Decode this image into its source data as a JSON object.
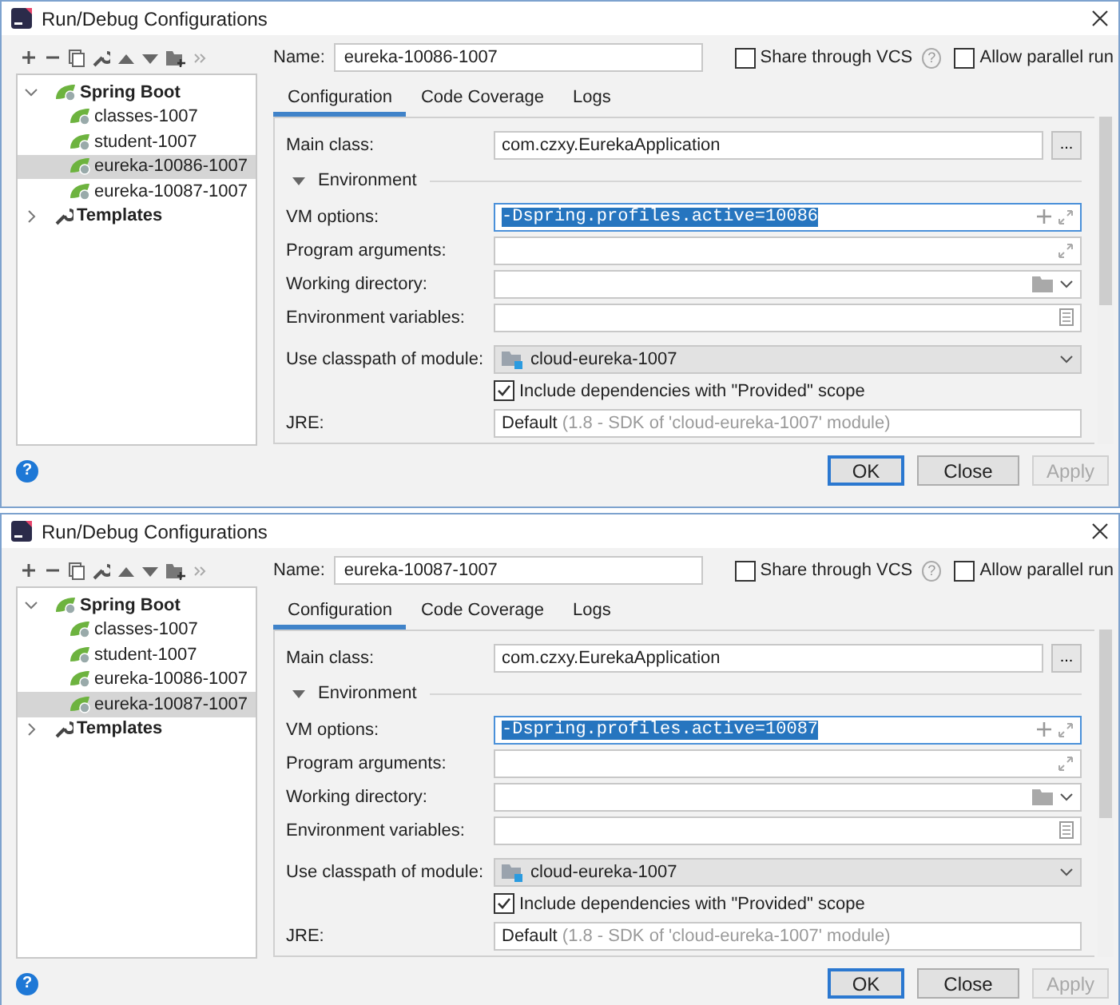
{
  "dialogs": [
    {
      "title": "Run/Debug Configurations",
      "name": {
        "label": "Name:",
        "value": "eureka-10086-1007"
      },
      "share": {
        "label": "Share through VCS",
        "checked": false,
        "help": "?"
      },
      "parallel": {
        "label": "Allow parallel run",
        "checked": false
      },
      "tree": [
        {
          "label": "Spring Boot",
          "kind": "group",
          "expanded": true,
          "selected": false,
          "children": [
            {
              "label": "classes-1007",
              "kind": "config",
              "selected": false
            },
            {
              "label": "student-1007",
              "kind": "config",
              "selected": false
            },
            {
              "label": "eureka-10086-1007",
              "kind": "config",
              "selected": true
            },
            {
              "label": "eureka-10087-1007",
              "kind": "config",
              "selected": false
            }
          ]
        },
        {
          "label": "Templates",
          "kind": "template",
          "expanded": false,
          "selected": false
        }
      ],
      "tabs": [
        {
          "label": "Configuration",
          "selected": true
        },
        {
          "label": "Code Coverage",
          "selected": false
        },
        {
          "label": "Logs",
          "selected": false
        }
      ],
      "form": {
        "main_class": {
          "label": "Main class:",
          "value": "com.czxy.EurekaApplication",
          "button": "..."
        },
        "environment": {
          "label": "Environment",
          "expanded": true
        },
        "fields": [
          {
            "label": "VM options:",
            "kind": "vm",
            "value": "-Dspring.profiles.active=10086",
            "focused": true,
            "text_selected": true
          },
          {
            "label": "Program arguments:",
            "kind": "expand",
            "focused": false
          },
          {
            "label": "Working directory:",
            "kind": "folder",
            "focused": false
          },
          {
            "label": "Environment variables:",
            "kind": "list",
            "focused": false
          }
        ],
        "module": {
          "label": "Use classpath of module:",
          "value": "cloud-eureka-1007"
        },
        "include": {
          "label": "Include dependencies with \"Provided\" scope",
          "checked": true
        },
        "jre": {
          "label": "JRE:",
          "value": "Default",
          "detail": "(1.8 - SDK of 'cloud-eureka-1007' module)"
        }
      },
      "help": "?",
      "buttons": [
        {
          "label": "OK",
          "kind": "default",
          "disabled": false
        },
        {
          "label": "Close",
          "kind": "normal",
          "disabled": false
        },
        {
          "label": "Apply",
          "kind": "normal",
          "disabled": true
        }
      ]
    },
    {
      "title": "Run/Debug Configurations",
      "name": {
        "label": "Name:",
        "value": "eureka-10087-1007"
      },
      "share": {
        "label": "Share through VCS",
        "checked": false,
        "help": "?"
      },
      "parallel": {
        "label": "Allow parallel run",
        "checked": false
      },
      "tree": [
        {
          "label": "Spring Boot",
          "kind": "group",
          "expanded": true,
          "selected": false,
          "children": [
            {
              "label": "classes-1007",
              "kind": "config",
              "selected": false
            },
            {
              "label": "student-1007",
              "kind": "config",
              "selected": false
            },
            {
              "label": "eureka-10086-1007",
              "kind": "config",
              "selected": false
            },
            {
              "label": "eureka-10087-1007",
              "kind": "config",
              "selected": true
            }
          ]
        },
        {
          "label": "Templates",
          "kind": "template",
          "expanded": false,
          "selected": false
        }
      ],
      "tabs": [
        {
          "label": "Configuration",
          "selected": true
        },
        {
          "label": "Code Coverage",
          "selected": false
        },
        {
          "label": "Logs",
          "selected": false
        }
      ],
      "form": {
        "main_class": {
          "label": "Main class:",
          "value": "com.czxy.EurekaApplication",
          "button": "..."
        },
        "environment": {
          "label": "Environment",
          "expanded": true
        },
        "fields": [
          {
            "label": "VM options:",
            "kind": "vm",
            "value": "-Dspring.profiles.active=10087",
            "focused": true,
            "text_selected": true
          },
          {
            "label": "Program arguments:",
            "kind": "expand",
            "focused": false
          },
          {
            "label": "Working directory:",
            "kind": "folder",
            "focused": false
          },
          {
            "label": "Environment variables:",
            "kind": "list",
            "focused": false
          }
        ],
        "module": {
          "label": "Use classpath of module:",
          "value": "cloud-eureka-1007"
        },
        "include": {
          "label": "Include dependencies with \"Provided\" scope",
          "checked": true
        },
        "jre": {
          "label": "JRE:",
          "value": "Default",
          "detail": "(1.8 - SDK of 'cloud-eureka-1007' module)"
        }
      },
      "help": "?",
      "buttons": [
        {
          "label": "OK",
          "kind": "default",
          "disabled": false
        },
        {
          "label": "Close",
          "kind": "normal",
          "disabled": false
        },
        {
          "label": "Apply",
          "kind": "normal",
          "disabled": true
        }
      ]
    }
  ]
}
